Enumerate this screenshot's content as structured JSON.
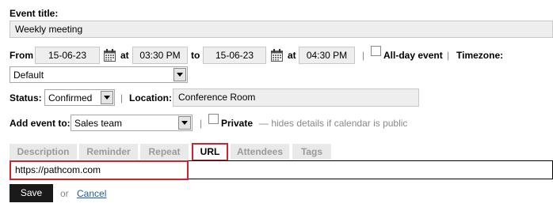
{
  "title_section": {
    "label": "Event title:",
    "value": "Weekly meeting"
  },
  "datetime": {
    "from_label": "From",
    "start_date": "15-06-23",
    "at_label": "at",
    "start_time": "03:30 PM",
    "to_label": "to",
    "end_date": "15-06-23",
    "at_label_2": "at",
    "end_time": "04:30 PM",
    "separator": "|",
    "allday_label": "All-day event",
    "separator_2": "|",
    "timezone_label": "Timezone:",
    "timezone_value": "Default"
  },
  "status_row": {
    "status_label": "Status:",
    "status_value": "Confirmed",
    "separator": "|",
    "location_label": "Location:",
    "location_value": "Conference Room"
  },
  "add_row": {
    "label": "Add event to:",
    "calendar_value": "Sales team",
    "separator": "|",
    "private_label": "Private",
    "private_hint": "— hides details if calendar is public"
  },
  "tabs": [
    {
      "label": "Description"
    },
    {
      "label": "Reminder"
    },
    {
      "label": "Repeat"
    },
    {
      "label": "URL"
    },
    {
      "label": "Attendees"
    },
    {
      "label": "Tags"
    }
  ],
  "url_input": {
    "value": "https://pathcom.com"
  },
  "actions": {
    "save_label": "Save",
    "or_label": "or",
    "cancel_label": "Cancel"
  },
  "colors": {
    "highlight": "#d2232a",
    "link": "#1a5fa0",
    "save_bg": "#1a1a1a",
    "field_bg": "#eeeeee"
  },
  "icons": {
    "calendar": "calendar-icon",
    "dropdown": "chevron-down-icon"
  }
}
